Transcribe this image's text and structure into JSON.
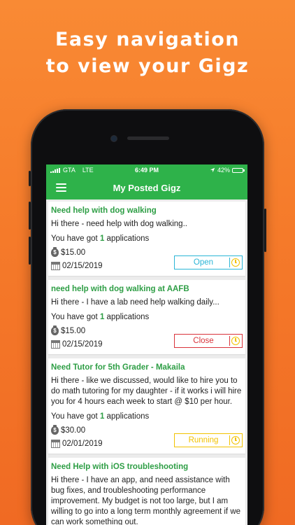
{
  "headline": {
    "line1": "Easy navigation",
    "line2": "to view your Gigz"
  },
  "status_bar": {
    "carrier": "GTA",
    "network": "LTE",
    "time": "6:49 PM",
    "battery": "42%",
    "battery_level": 0.42
  },
  "nav": {
    "title": "My Posted Gigz",
    "menu_icon": "hamburger-menu-icon"
  },
  "colors": {
    "brand_green": "#2eb24a",
    "title_green": "#2e9e45",
    "open": "#2bb5d6",
    "close": "#d9343b",
    "running": "#f2c200"
  },
  "gigs": [
    {
      "title": "Need help with dog walking",
      "description": "Hi there - need help with dog walking..",
      "apps_prefix": "You have got",
      "apps_count": "1",
      "apps_suffix": "applications",
      "price": "$15.00",
      "date": "02/15/2019",
      "status": "Open"
    },
    {
      "title": "need help with dog walking at AAFB",
      "description": "Hi there - I have a lab need help walking daily...",
      "apps_prefix": "You have got",
      "apps_count": "1",
      "apps_suffix": "applications",
      "price": "$15.00",
      "date": "02/15/2019",
      "status": "Close"
    },
    {
      "title": "Need Tutor for 5th Grader - Makaila",
      "description": "Hi there - like we discussed, would like to hire you to do math tutoring for my daughter - if it works i will hire you for 4 hours each week to start @ $10 per hour.",
      "apps_prefix": "You have got",
      "apps_count": "1",
      "apps_suffix": "applications",
      "price": "$30.00",
      "date": "02/01/2019",
      "status": "Running"
    },
    {
      "title": "Need Help with iOS troubleshooting",
      "description": "Hi there - I have an app, and need assistance with bug fixes, and troubleshooting performance improvement. My budget is not too large, but I am willing to go into a long term monthly agreement if we can work something out."
    }
  ]
}
